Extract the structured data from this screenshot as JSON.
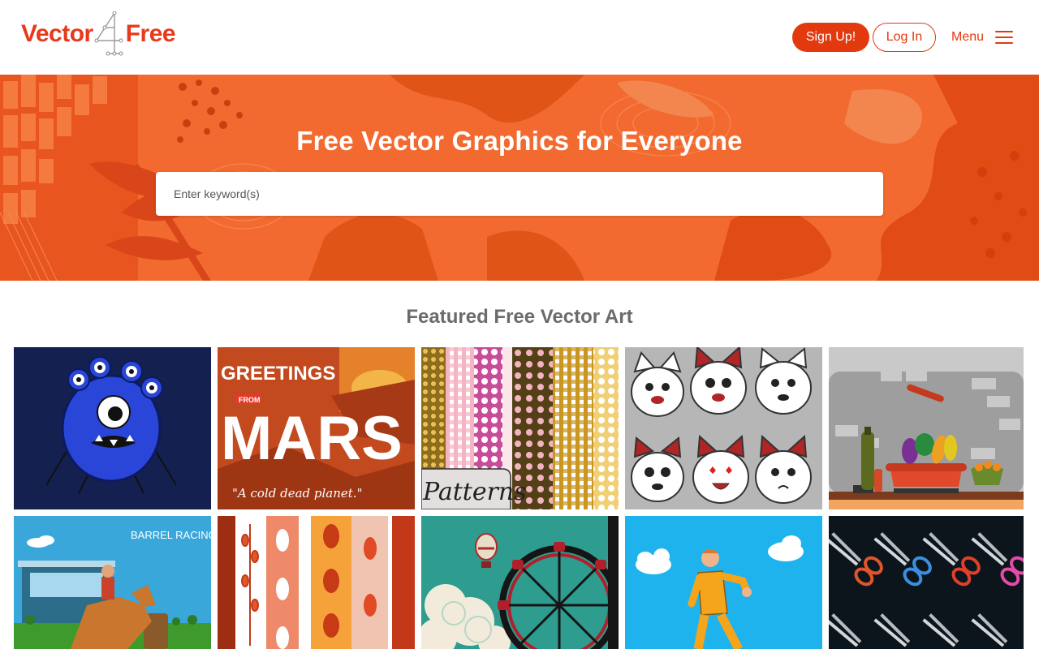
{
  "header": {
    "logo": {
      "part1": "Vector",
      "part2": "Free",
      "mark": "4"
    },
    "signup_label": "Sign Up!",
    "login_label": "Log In",
    "menu_label": "Menu",
    "menu_icon": "hamburger-icon"
  },
  "hero": {
    "title": "Free Vector Graphics for Everyone",
    "search_placeholder": "Enter keyword(s)"
  },
  "featured": {
    "title": "Featured Free Vector Art",
    "items": [
      {
        "name": "blue-monster",
        "caption": ""
      },
      {
        "name": "greetings-from-mars",
        "text_top": "GREETINGS",
        "text_from": "FROM",
        "text_main": "MARS",
        "text_sub": "\"A cold dead planet.\""
      },
      {
        "name": "patterns",
        "text": "Patterns"
      },
      {
        "name": "cartoon-cats-stickers"
      },
      {
        "name": "cooking-pot-vegetables"
      },
      {
        "name": "barrel-racing",
        "text": "BARREL RACING"
      },
      {
        "name": "autumn-leaf-patterns"
      },
      {
        "name": "ferris-wheel"
      },
      {
        "name": "man-walking-sky"
      },
      {
        "name": "scissors-pattern"
      }
    ]
  },
  "colors": {
    "brand": "#e2390f",
    "hero": "#f36a33",
    "logo": "#e8391a"
  }
}
